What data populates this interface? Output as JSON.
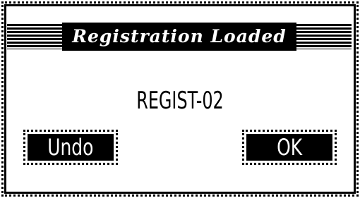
{
  "dialog": {
    "title": "Registration Loaded",
    "message": "REGIST-02",
    "buttons": {
      "undo_label": "Undo",
      "ok_label": "OK"
    }
  }
}
